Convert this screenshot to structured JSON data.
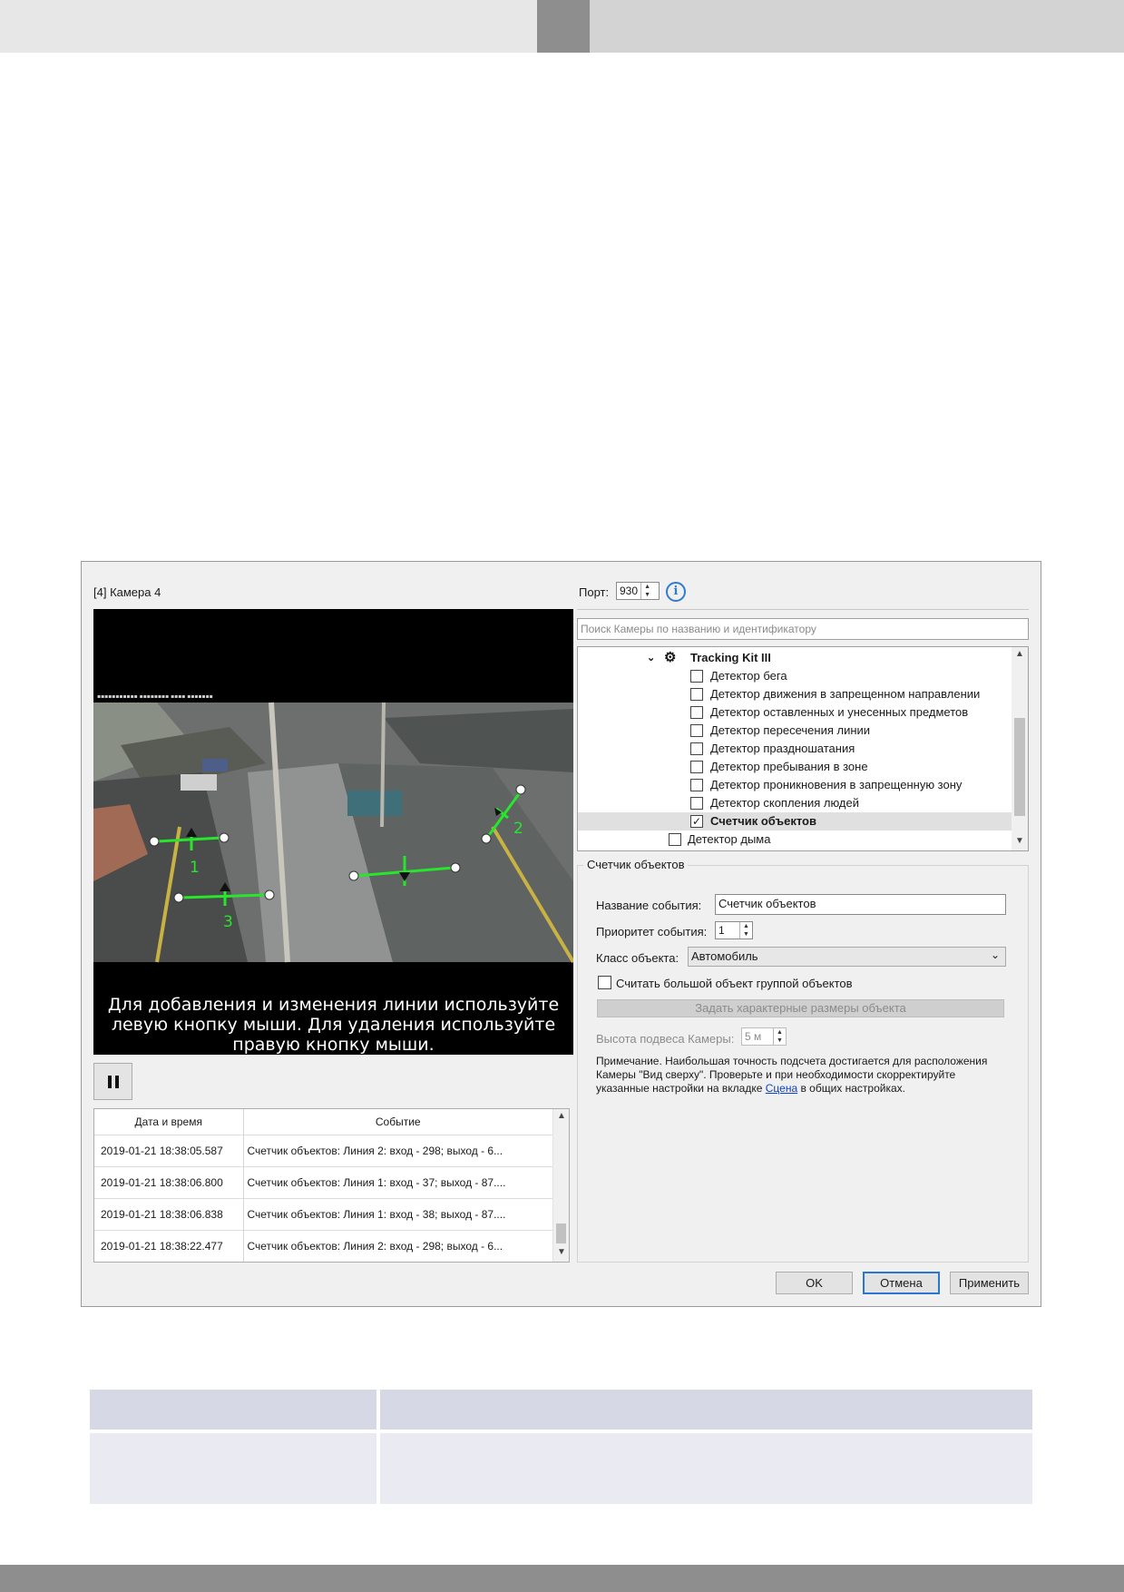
{
  "dialog": {
    "camera_title": "[4] Камера 4",
    "port_label": "Порт:",
    "port_value": "930",
    "search_placeholder": "Поиск Камеры по названию и идентификатору",
    "video_overlay_text": "Для добавления и изменения линии используйте левую кнопку мыши. Для удаления используйте правую кнопку мыши.",
    "line_labels": [
      "1",
      "2",
      "3"
    ],
    "events_table": {
      "headers": [
        "Дата и время",
        "Событие"
      ],
      "rows": [
        [
          "2019-01-21 18:38:05.587",
          "Счетчик объектов: Линия 2: вход - 298; выход - 6..."
        ],
        [
          "2019-01-21 18:38:06.800",
          "Счетчик объектов: Линия 1: вход - 37; выход - 87...."
        ],
        [
          "2019-01-21 18:38:06.838",
          "Счетчик объектов: Линия 1: вход - 38; выход - 87...."
        ],
        [
          "2019-01-21 18:38:22.477",
          "Счетчик объектов: Линия 2: вход - 298; выход - 6..."
        ]
      ]
    },
    "tree": {
      "parent": "Tracking Kit III",
      "items": [
        {
          "label": "Детектор бега",
          "checked": false
        },
        {
          "label": "Детектор движения в запрещенном направлении",
          "checked": false
        },
        {
          "label": "Детектор оставленных и унесенных предметов",
          "checked": false
        },
        {
          "label": "Детектор пересечения линии",
          "checked": false
        },
        {
          "label": "Детектор праздношатания",
          "checked": false
        },
        {
          "label": "Детектор пребывания в зоне",
          "checked": false
        },
        {
          "label": "Детектор проникновения в запрещенную зону",
          "checked": false
        },
        {
          "label": "Детектор скопления людей",
          "checked": false
        },
        {
          "label": "Счетчик объектов",
          "checked": true
        }
      ],
      "next_item": "Детектор дыма"
    },
    "settings": {
      "group_title": "Счетчик объектов",
      "event_name_label": "Название события:",
      "event_name_value": "Счетчик объектов",
      "priority_label": "Приоритет события:",
      "priority_value": "1",
      "class_label": "Класс объекта:",
      "class_value": "Автомобиль",
      "group_checkbox_label": "Считать большой объект группой объектов",
      "set_sizes_button": "Задать характерные размеры объекта",
      "height_label": "Высота подвеса Камеры:",
      "height_value": "5 м",
      "note_text": "Примечание. Наибольшая точность подсчета достигается для расположения Камеры \"Вид сверху\". Проверьте и при необходимости скорректируйте указанные настройки на вкладке",
      "note_link": "Сцена",
      "note_tail": "в общих настройках."
    },
    "buttons": {
      "ok": "OK",
      "cancel": "Отмена",
      "apply": "Применить"
    }
  },
  "colors": {
    "header_light": "#e7e7e7",
    "header_mid": "#8e8e8e",
    "header_right": "#d3d3d3",
    "table_header": "#d6d8e6",
    "table_row": "#e9eaf2",
    "overlay_green": "#27e62c"
  },
  "icons": [
    "info-icon",
    "gear-icon",
    "chevron-down-icon",
    "pause-icon",
    "checkbox-icon"
  ]
}
